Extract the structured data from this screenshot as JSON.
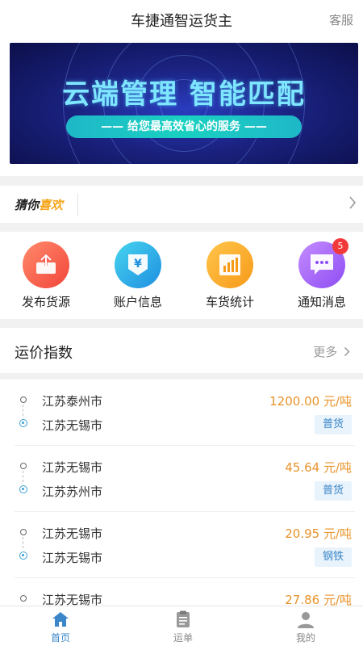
{
  "header": {
    "title": "车捷通智运货主",
    "service_label": "客服"
  },
  "banner": {
    "headline": "云端管理 智能匹配",
    "tagline": "—— 给您最高效省心的服务 ——"
  },
  "guess": {
    "label_part1": "猜你",
    "label_part2": "喜欢"
  },
  "quick_actions": [
    {
      "label": "发布货源",
      "icon": "publish-icon",
      "glyph": "⇪",
      "color_from": "#ff8a6b",
      "color_to": "#f2453a"
    },
    {
      "label": "账户信息",
      "icon": "account-yen-icon",
      "glyph": "¥",
      "color_from": "#46d4ef",
      "color_to": "#1f8fe0"
    },
    {
      "label": "车货统计",
      "icon": "stats-chart-icon",
      "glyph": "▮▮",
      "color_from": "#ffc54a",
      "color_to": "#f79a1a"
    },
    {
      "label": "通知消息",
      "icon": "message-icon",
      "glyph": "•••",
      "color_from": "#c58cff",
      "color_to": "#8d4df2",
      "badge": "5"
    }
  ],
  "freight_index": {
    "title": "运价指数",
    "more_label": "更多"
  },
  "routes": [
    {
      "from": "江苏泰州市",
      "to": "江苏无锡市",
      "price": "1200.00 元/吨",
      "cargo": "普货"
    },
    {
      "from": "江苏无锡市",
      "to": "江苏苏州市",
      "price": "45.64 元/吨",
      "cargo": "普货"
    },
    {
      "from": "江苏无锡市",
      "to": "江苏无锡市",
      "price": "20.95 元/吨",
      "cargo": "钢铁"
    },
    {
      "from": "江苏无锡市",
      "to": "",
      "price": "27.86 元/吨",
      "cargo": ""
    }
  ],
  "tabs": [
    {
      "label": "首页",
      "icon": "home-icon",
      "active": true
    },
    {
      "label": "运单",
      "icon": "clipboard-icon",
      "active": false
    },
    {
      "label": "我的",
      "icon": "user-icon",
      "active": false
    }
  ],
  "colors": {
    "accent": "#3a86c8",
    "price": "#e8932a",
    "badge": "#f33a3a"
  }
}
